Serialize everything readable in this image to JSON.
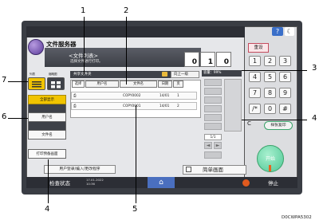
{
  "callouts": [
    "1",
    "2",
    "3",
    "4",
    "5",
    "6",
    "7"
  ],
  "caption": "D0CWPA5302",
  "topbar": {
    "help": "?",
    "moon": "☾"
  },
  "header": {
    "app_title": "文件服务器",
    "list_title": "<文件列表>",
    "list_subtitle": "选择文件进行打印。",
    "counters": [
      {
        "label": "",
        "value": "0"
      },
      {
        "label": "",
        "value": "1"
      },
      {
        "label": "",
        "value": "0"
      }
    ]
  },
  "folder_bar": {
    "label": "共享文件夹",
    "up_button": "向上一级"
  },
  "table": {
    "headers": [
      "选择",
      "用户名",
      "文件名",
      "日期",
      "页"
    ],
    "rows": [
      {
        "icon": "⎙",
        "user": "",
        "file": "COPY0002",
        "date": "14/01",
        "pages": "1"
      },
      {
        "icon": "⎙",
        "user": "",
        "file": "COPY0001",
        "date": "14/01",
        "pages": "2"
      }
    ]
  },
  "left_panel": {
    "mode_labels": [
      "列表",
      "缩略图"
    ],
    "show_all": "全部显示",
    "user_name": "用户名",
    "file_name": "文件名",
    "print_button": "打印预备画面",
    "register_button": "用户登录/编入/更改程序"
  },
  "right_panel": {
    "capacity": "容量：99%",
    "page_indicator": "1/1",
    "side_buttons": [
      "",
      "",
      "",
      "",
      "",
      "",
      ""
    ],
    "page_prev": "◄",
    "page_next": "►"
  },
  "bottom_bar": {
    "status": "检查状态",
    "date": "17.01.2022",
    "time": "10:36",
    "home": "⌂",
    "stop": "停止"
  },
  "keypad": {
    "reset": "重设",
    "keys": [
      "1",
      "2",
      "3",
      "4",
      "5",
      "6",
      "7",
      "8",
      "9",
      "/*",
      "0",
      "#"
    ],
    "clear": "C",
    "sample_copy": "样张复印",
    "start": "开始",
    "simple_screen": "简单画面"
  }
}
